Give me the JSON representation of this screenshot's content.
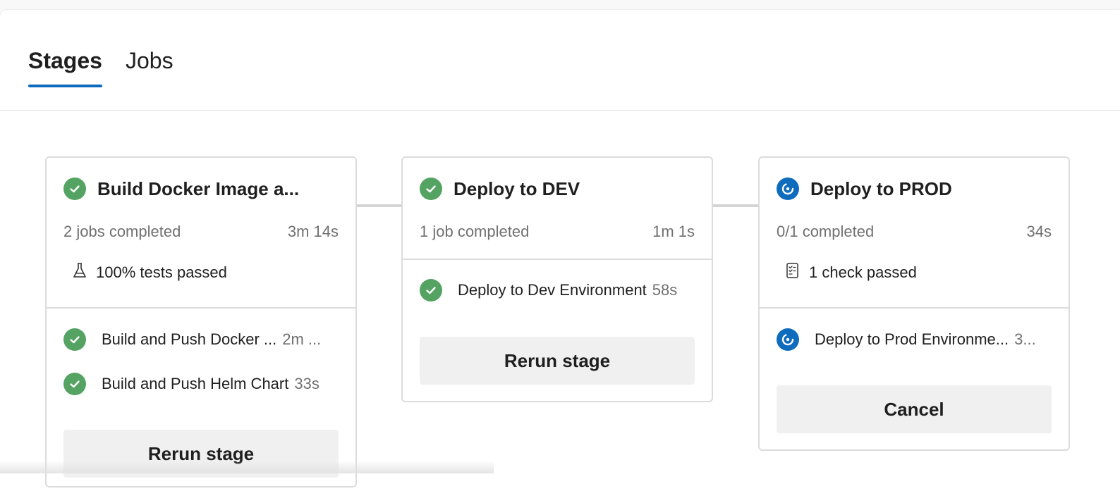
{
  "tabs": [
    {
      "label": "Stages",
      "active": true
    },
    {
      "label": "Jobs",
      "active": false
    }
  ],
  "colors": {
    "accent": "#0f6cbd",
    "success": "#55a362",
    "muted_text": "#707070",
    "button_bg": "#f0f0f0"
  },
  "stages": [
    {
      "title": "Build Docker Image a...",
      "status_icon": "success-check-icon",
      "summary": "2 jobs completed",
      "duration": "3m 14s",
      "extra": {
        "icon": "flask-icon",
        "text": "100% tests passed"
      },
      "jobs": [
        {
          "name": "Build and Push Docker ...",
          "duration": "2m ...",
          "status_icon": "success-check-icon"
        },
        {
          "name": "Build and Push Helm Chart",
          "duration": "33s",
          "status_icon": "success-check-icon"
        }
      ],
      "action_label": "Rerun stage"
    },
    {
      "title": "Deploy to DEV",
      "status_icon": "success-check-icon",
      "summary": "1 job completed",
      "duration": "1m 1s",
      "jobs": [
        {
          "name": "Deploy to Dev Environment",
          "duration": "58s",
          "status_icon": "success-check-icon"
        }
      ],
      "action_label": "Rerun stage"
    },
    {
      "title": "Deploy to PROD",
      "status_icon": "in-progress-icon",
      "summary": "0/1 completed",
      "duration": "34s",
      "extra": {
        "icon": "checklist-icon",
        "text": "1 check passed"
      },
      "jobs": [
        {
          "name": "Deploy to Prod Environme...",
          "duration": "3...",
          "status_icon": "in-progress-icon"
        }
      ],
      "action_label": "Cancel"
    }
  ]
}
